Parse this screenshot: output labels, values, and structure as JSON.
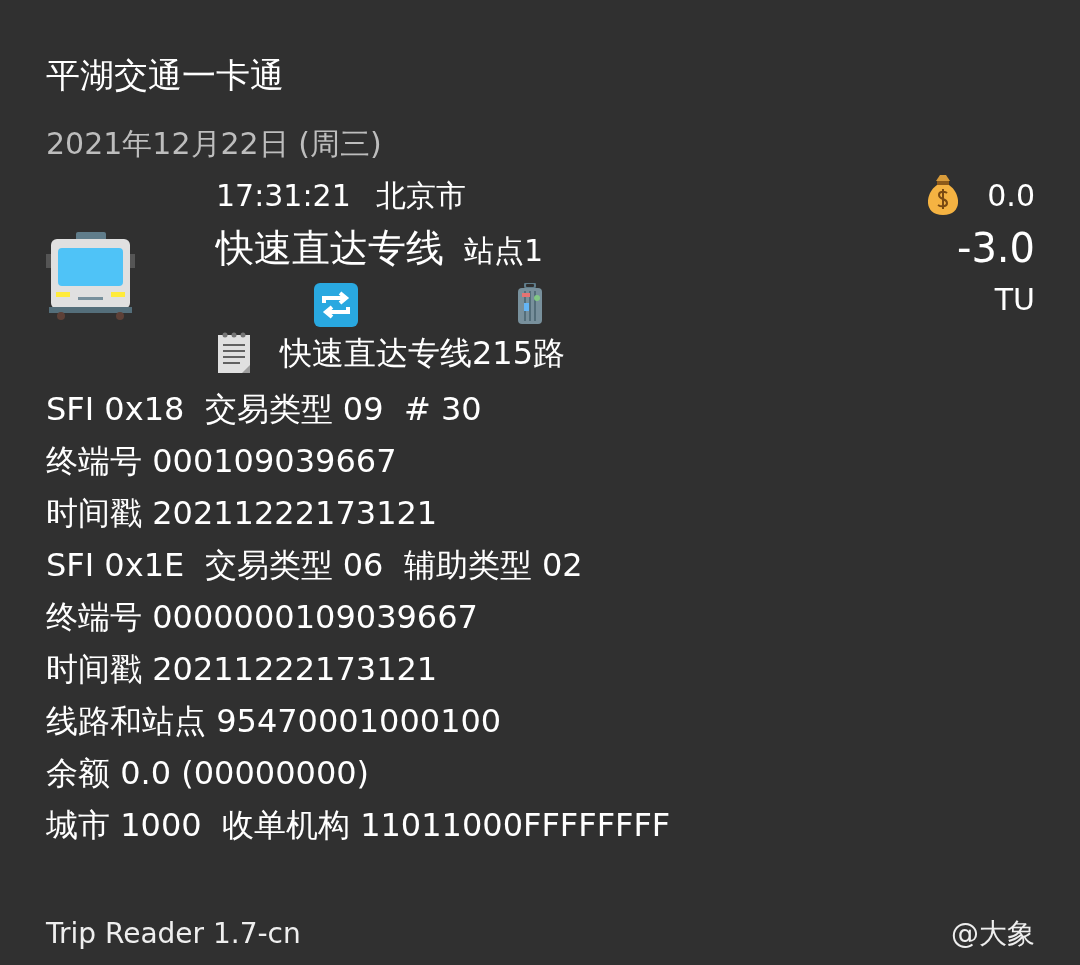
{
  "title": "平湖交通一卡通",
  "date": "2021年12月22日 (周三)",
  "trip": {
    "time": "17:31:21",
    "city": "北京市",
    "route": "快速直达专线",
    "station": "站点1",
    "balance": "0.0",
    "amount": "-3.0",
    "currency": "TU",
    "note": "快速直达专线215路"
  },
  "details": [
    "SFI 0x18  交易类型 09  # 30",
    "终端号 000109039667",
    "时间戳 20211222173121",
    "SFI 0x1E  交易类型 06  辅助类型 02",
    "终端号 0000000109039667",
    "时间戳 20211222173121",
    "线路和站点 95470001000100",
    "余额 0.0 (00000000)",
    "城市 1000  收单机构 11011000FFFFFFFF"
  ],
  "footer": {
    "app": "Trip Reader 1.7-cn",
    "author": "@大象"
  }
}
